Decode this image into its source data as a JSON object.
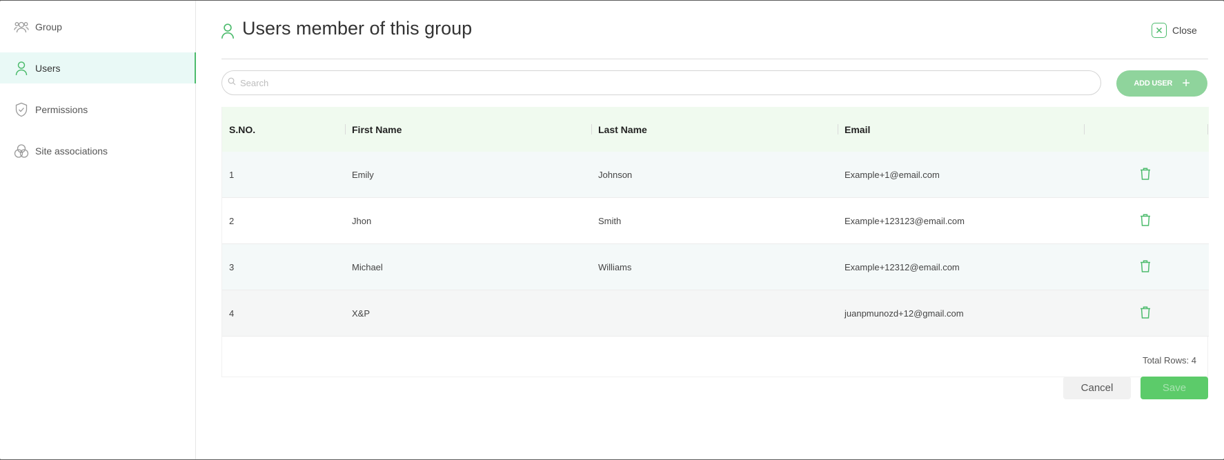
{
  "sidebar": {
    "items": [
      {
        "label": "Group",
        "icon": "group-icon"
      },
      {
        "label": "Users",
        "icon": "user-icon",
        "active": true
      },
      {
        "label": "Permissions",
        "icon": "shield-check-icon"
      },
      {
        "label": "Site associations",
        "icon": "circles-icon"
      }
    ]
  },
  "header": {
    "title": "Users member of this group",
    "close_label": "Close"
  },
  "search": {
    "placeholder": "Search",
    "value": ""
  },
  "toolbar": {
    "add_user_label": "ADD USER"
  },
  "table": {
    "columns": [
      "S.NO.",
      "First Name",
      "Last Name",
      "Email"
    ],
    "rows": [
      {
        "sno": "1",
        "first": "Emily",
        "last": "Johnson",
        "email": "Example+1@email.com"
      },
      {
        "sno": "2",
        "first": "Jhon",
        "last": "Smith",
        "email": "Example+123123@email.com"
      },
      {
        "sno": "3",
        "first": "Michael",
        "last": "Williams",
        "email": "Example+12312@email.com"
      },
      {
        "sno": "4",
        "first": "X&P",
        "last": "",
        "email": "juanpmunozd+12@gmail.com"
      }
    ],
    "total_rows_label": "Total Rows: 4"
  },
  "footer": {
    "cancel_label": "Cancel",
    "save_label": "Save"
  },
  "colors": {
    "accent": "#4cbb6c",
    "header_bg": "#f0faef",
    "active_nav_bg": "#e9f9f6"
  }
}
